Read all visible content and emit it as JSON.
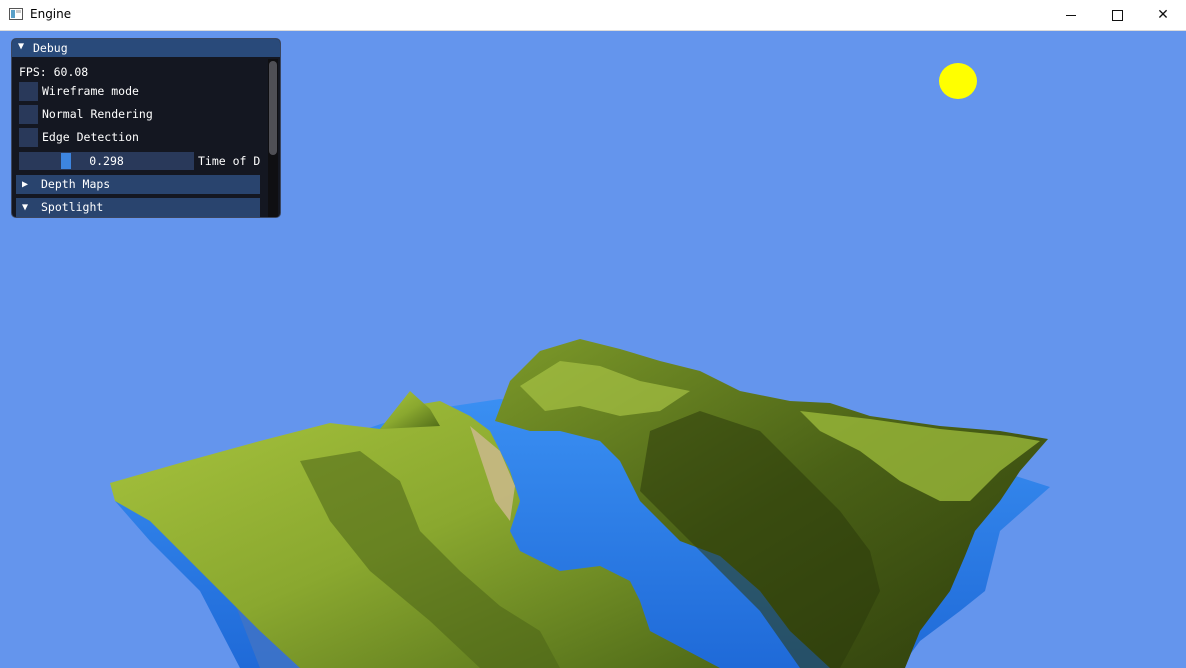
{
  "window": {
    "title": "Engine",
    "min_label": "minimize",
    "max_label": "maximize",
    "close_label": "✕"
  },
  "scene": {
    "sky_color": "#6495ED",
    "sun_color": "#FFFF00",
    "water_color": "#2F86F0",
    "terrain_color": "#8FB033"
  },
  "debug": {
    "title": "Debug",
    "fps": "FPS: 60.08",
    "checkboxes": [
      {
        "label": "Wireframe mode",
        "checked": false
      },
      {
        "label": "Normal Rendering",
        "checked": false
      },
      {
        "label": "Edge Detection",
        "checked": false
      }
    ],
    "slider": {
      "value": "0.298",
      "label": "Time of D"
    },
    "sections": [
      {
        "label": "Depth Maps",
        "open": false
      },
      {
        "label": "Spotlight",
        "open": true
      }
    ]
  }
}
